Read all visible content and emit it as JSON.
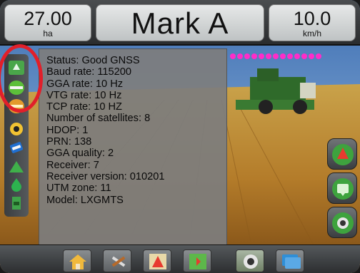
{
  "header": {
    "area_value": "27.00",
    "area_unit": "ha",
    "mark_title": "Mark A",
    "speed_value": "10.0",
    "speed_unit": "km/h"
  },
  "gnss_info": {
    "lines": [
      "Status: Good GNSS",
      "Baud rate:  115200",
      "GGA rate: 10 Hz",
      "VTG rate: 10 Hz",
      "TCP rate: 10 HZ",
      "Number of satellites: 8",
      "HDOP: 1",
      "PRN: 138",
      "GGA quality: 2",
      "Receiver: 7",
      "Receiver version: 010201",
      "UTM zone: 11",
      "Model: LXGMTS"
    ]
  },
  "left_toolbar": {
    "icons": [
      "gnss-status-icon",
      "guidance-line-icon",
      "boom-status-icon",
      "warning-icon",
      "tilt-icon",
      "marker-icon",
      "tank-icon",
      "bookmark-icon"
    ]
  },
  "right_toolbar": {
    "icons": [
      "vehicle-view-icon",
      "panel-icon",
      "camera-zoom-icon"
    ]
  },
  "bottom_toolbar": {
    "icons": [
      "home-icon",
      "tools-icon",
      "vehicle-view-icon",
      "map-icon",
      "camera-icon",
      "overview-icon"
    ],
    "active": "camera-icon"
  },
  "colors": {
    "highlight": "#e11f2a",
    "gnss_green": "#3aa63a",
    "accent_blue": "#2f8fd8"
  }
}
